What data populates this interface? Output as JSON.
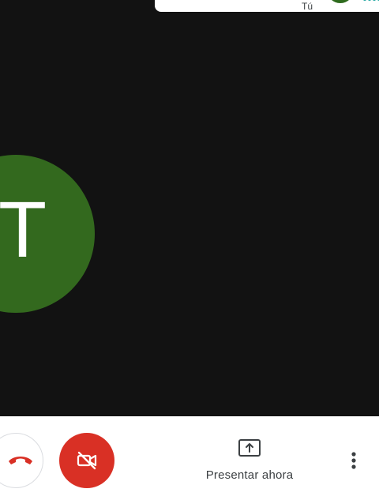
{
  "self_tile": {
    "label": "Tú",
    "avatar_color": "#2f6b1e",
    "audio_indicator_color": "#1aa5a0",
    "avatar_icon": "avatar-icon",
    "audio_icon": "audio-dots-icon"
  },
  "participant": {
    "initial": "T",
    "avatar_color": "#33691e"
  },
  "controls": {
    "hangup_icon": "phone-hangup-icon",
    "hangup_color": "#d93025",
    "video_icon": "video-off-icon",
    "video_button_color": "#d93025",
    "present_icon": "present-screen-icon",
    "present_label": "Presentar ahora",
    "more_icon": "more-vert-icon"
  },
  "colors": {
    "stage_bg": "#121212",
    "bar_bg": "#ffffff",
    "text": "#3c4043"
  }
}
